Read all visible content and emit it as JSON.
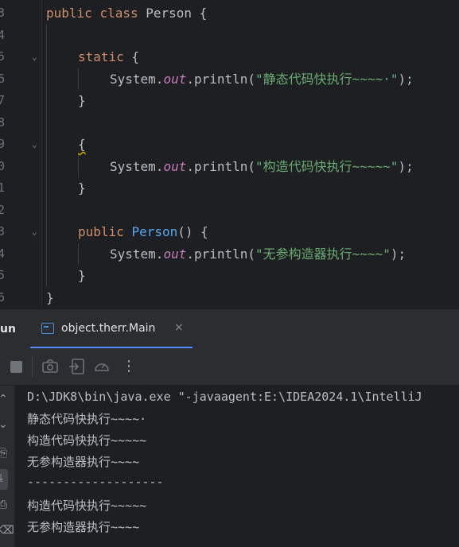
{
  "editor": {
    "line_numbers": [
      "3",
      "4",
      "5",
      "6",
      "7",
      "8",
      "9",
      "0",
      "1",
      "2",
      "3",
      "4",
      "5",
      "6"
    ],
    "lines": {
      "l1": {
        "kw1": "public",
        "kw2": "class",
        "name": "Person",
        "brace": " {"
      },
      "l3": {
        "kw": "static",
        "brace": " {"
      },
      "l4": {
        "obj": "System.",
        "field": "out",
        "call": ".println(",
        "str": "\"静态代码快执行~~~~·\"",
        "end": ");"
      },
      "l5": {
        "text": "}"
      },
      "l7": {
        "text": "{"
      },
      "l8": {
        "obj": "System.",
        "field": "out",
        "call": ".println(",
        "str": "\"构造代码快执行~~~~~\"",
        "end": ");"
      },
      "l9": {
        "text": "}"
      },
      "l11": {
        "kw": "public",
        "name": "Person",
        "rest": "() {"
      },
      "l12": {
        "obj": "System.",
        "field": "out",
        "call": ".println(",
        "str": "\"无参构造器执行~~~~\"",
        "end": ");"
      },
      "l13": {
        "text": "}"
      },
      "l14": {
        "text": "}"
      }
    }
  },
  "run_panel": {
    "label": "un",
    "tab_label": "object.therr.Main",
    "tab_close": "×",
    "more": "⋮"
  },
  "console": {
    "lines": [
      "D:\\JDK8\\bin\\java.exe \"-javaagent:E:\\IDEA2024.1\\IntelliJ",
      "静态代码快执行~~~~·",
      "构造代码快执行~~~~~",
      "无参构造器执行~~~~",
      "-------------------",
      "构造代码快执行~~~~~",
      "无参构造器执行~~~~"
    ],
    "side_glyphs": [
      "⌃",
      "⌄",
      "⎘",
      "⤓",
      "⎙",
      "⌫"
    ]
  }
}
